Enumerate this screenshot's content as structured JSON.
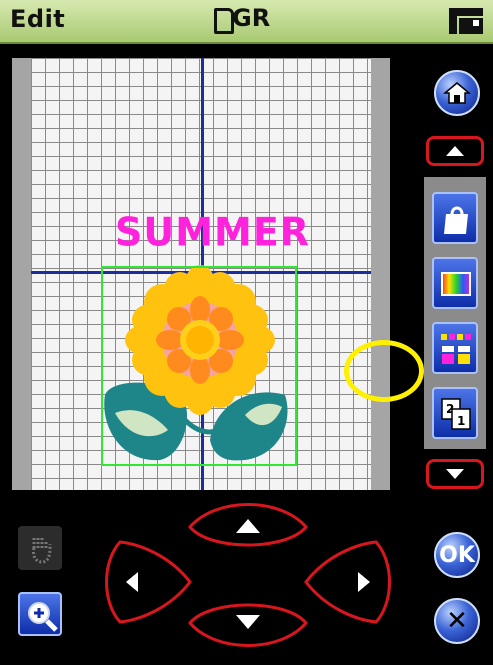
{
  "header": {
    "title": "Edit",
    "storage_label": "GR",
    "storage_icon": "sd-card-icon",
    "machine_icon": "embroidery-machine-icon"
  },
  "canvas": {
    "text": "SUMMER",
    "text_color": "#ff22dd",
    "axis_color": "#1b2f9a",
    "selection_color": "#33e633"
  },
  "sidebar": {
    "home_icon": "home-icon",
    "tools": [
      "bag-icon",
      "color-palette-icon",
      "color-sort-icon",
      "layer-order-icon"
    ]
  },
  "footer": {
    "ok_label": "OK",
    "cancel_label": "✕"
  },
  "highlight_color": "#ffef00"
}
